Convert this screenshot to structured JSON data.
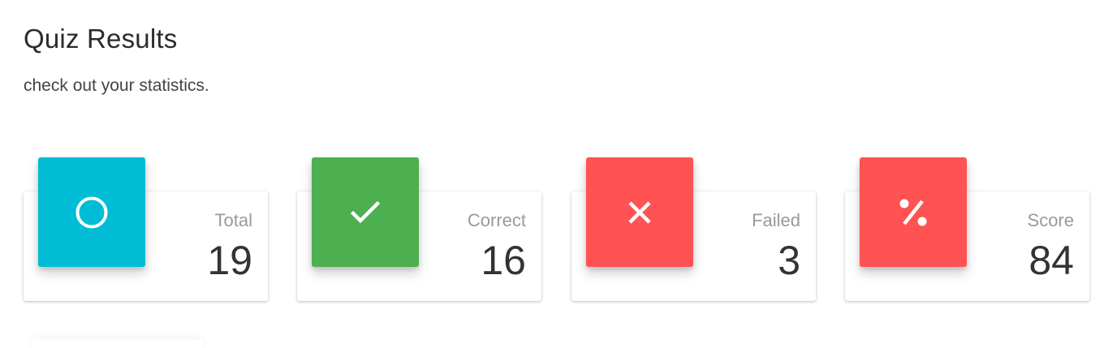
{
  "header": {
    "title": "Quiz Results",
    "subtitle": "check out your statistics."
  },
  "stats": [
    {
      "label": "Total",
      "value": "19",
      "icon": "circle-icon",
      "color": "#00BCD4"
    },
    {
      "label": "Correct",
      "value": "16",
      "icon": "check-icon",
      "color": "#4CAF50"
    },
    {
      "label": "Failed",
      "value": "3",
      "icon": "close-icon",
      "color": "#FF5252"
    },
    {
      "label": "Score",
      "value": "84",
      "icon": "percent-icon",
      "color": "#FF5252"
    }
  ]
}
